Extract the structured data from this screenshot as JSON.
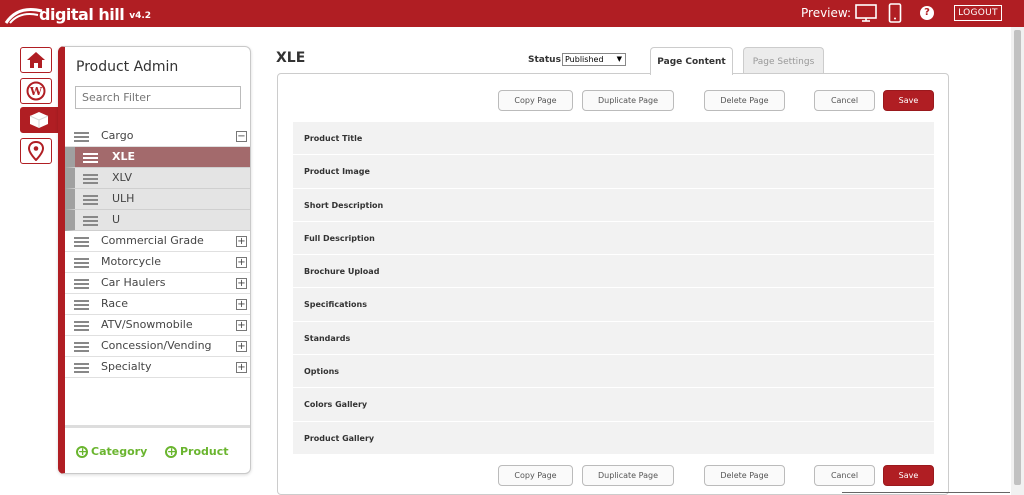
{
  "app": {
    "brand": "digital hill",
    "version": "v4.2"
  },
  "header": {
    "preview_label": "Preview:",
    "help_label": "?",
    "logout_label": "LOGOUT"
  },
  "rail": [
    {
      "name": "home-icon"
    },
    {
      "name": "wordpress-icon"
    },
    {
      "name": "product-box-icon",
      "active": true
    },
    {
      "name": "location-pin-icon"
    }
  ],
  "sidebar": {
    "title": "Product Admin",
    "search_placeholder": "Search Filter",
    "items": [
      {
        "label": "Cargo",
        "toggle": "−",
        "children": [
          {
            "label": "XLE",
            "selected": true
          },
          {
            "label": "XLV"
          },
          {
            "label": "ULH"
          },
          {
            "label": "U"
          }
        ]
      },
      {
        "label": "Commercial Grade",
        "toggle": "+"
      },
      {
        "label": "Motorcycle",
        "toggle": "+"
      },
      {
        "label": "Car Haulers",
        "toggle": "+"
      },
      {
        "label": "Race",
        "toggle": "+"
      },
      {
        "label": "ATV/Snowmobile",
        "toggle": "+"
      },
      {
        "label": "Concession/Vending",
        "toggle": "+"
      },
      {
        "label": "Specialty",
        "toggle": "+"
      }
    ],
    "add_category": "Category",
    "add_product": "Product"
  },
  "main": {
    "title": "XLE",
    "status_label": "Status",
    "status_value": "Published",
    "tabs": [
      {
        "label": "Page Content",
        "active": true
      },
      {
        "label": "Page Settings",
        "active": false
      }
    ],
    "actions": {
      "copy": "Copy Page",
      "duplicate": "Duplicate Page",
      "delete": "Delete Page",
      "cancel": "Cancel",
      "save": "Save"
    },
    "fields": [
      "Product Title",
      "Product Image",
      "Short Description",
      "Full Description",
      "Brochure Upload",
      "Specifications",
      "Standards",
      "Options",
      "Colors Gallery",
      "Product Gallery"
    ]
  },
  "colors": {
    "brand_red": "#b01e23",
    "selected_row": "#a36a6c",
    "add_green": "#6ab52f"
  }
}
